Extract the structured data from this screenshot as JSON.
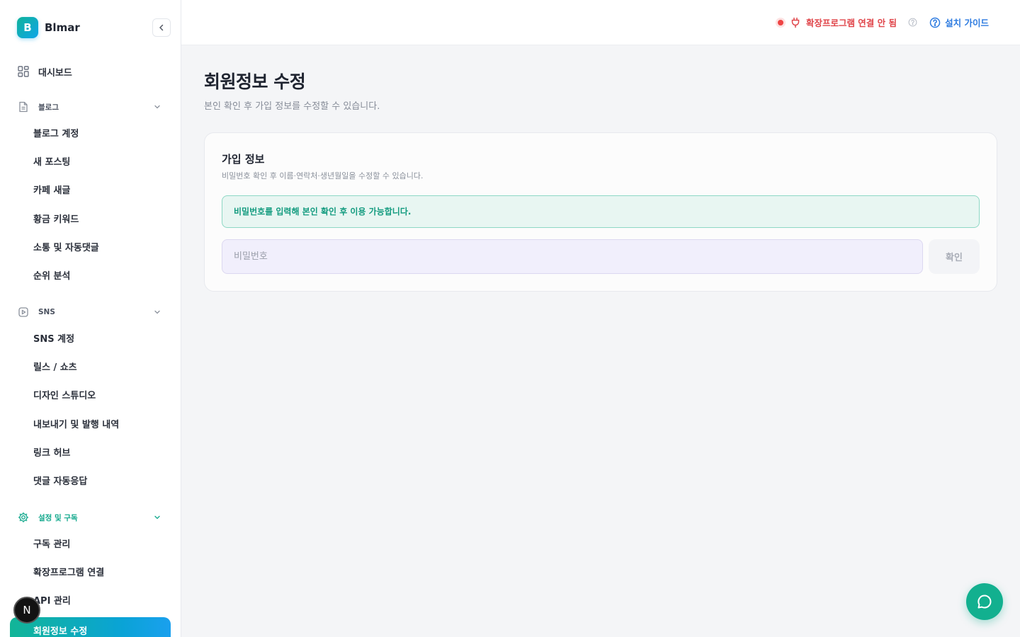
{
  "brand": {
    "logo_letter": "B",
    "name": "Blmar"
  },
  "sidebar": {
    "dashboard": "대시보드",
    "groups": [
      {
        "label": "블로그",
        "items": [
          "블로그 계정",
          "새 포스팅",
          "카페 새글",
          "황금 키워드",
          "소통 및 자동댓글",
          "순위 분석"
        ]
      },
      {
        "label": "SNS",
        "items": [
          "SNS 계정",
          "릴스 / 쇼츠",
          "디자인 스튜디오",
          "내보내기 및 발행 내역",
          "링크 허브",
          "댓글 자동응답"
        ]
      },
      {
        "label": "설정 및 구독",
        "items": [
          "구독 관리",
          "확장프로그램 연결",
          "API 관리",
          "회원정보 수정"
        ]
      }
    ],
    "active_item": "회원정보 수정",
    "floating_badge": "N"
  },
  "header": {
    "extension_status": "확장프로그램 연결 안 됨",
    "install_guide": "설치 가이드"
  },
  "main": {
    "title": "회원정보 수정",
    "subtitle": "본인 확인 후 가입 정보를 수정할 수 있습니다.",
    "card": {
      "title": "가입 정보",
      "description": "비밀번호 확인 후 이름·연락처·생년월일을 수정할 수 있습니다.",
      "notice": "비밀번호를 입력해 본인 확인 후 이용 가능합니다.",
      "password_placeholder": "비밀번호",
      "password_value": "",
      "confirm_label": "확인"
    }
  },
  "colors": {
    "accent": "#12b08f",
    "error": "#e0454a",
    "link": "#2d7be0"
  },
  "icons": {
    "dashboard": "grid-icon",
    "blog": "document-icon",
    "sns": "play-icon",
    "settings": "gear-icon",
    "chat": "chat-bubble-icon"
  }
}
